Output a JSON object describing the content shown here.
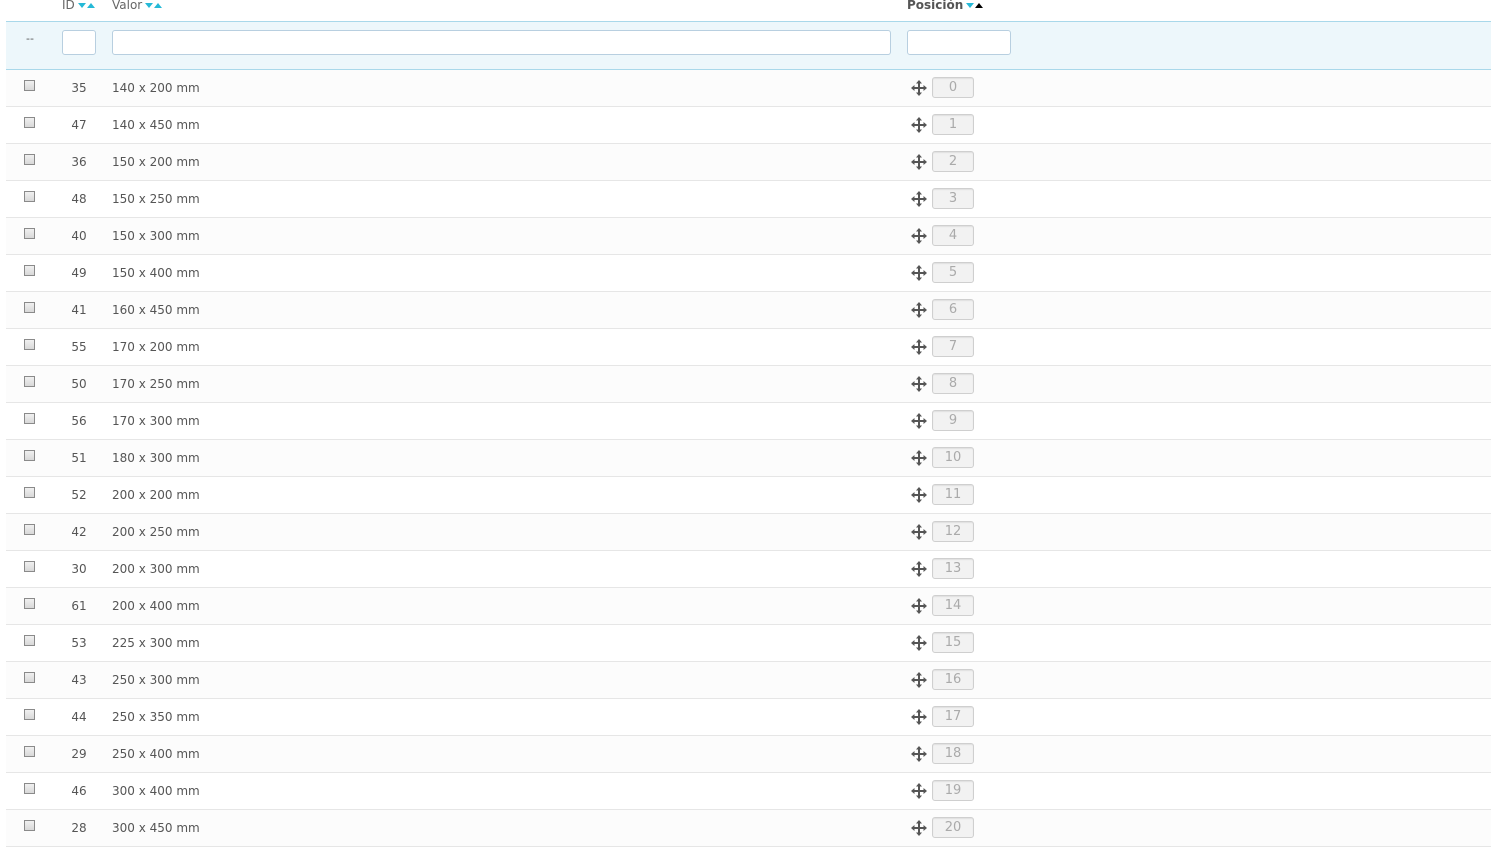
{
  "header": {
    "id_label": "ID",
    "value_label": "Valor",
    "position_label": "Posición",
    "filter_placeholder": "--"
  },
  "rows": [
    {
      "id": "35",
      "value": "140 x 200 mm",
      "position": "0"
    },
    {
      "id": "47",
      "value": "140 x 450 mm",
      "position": "1"
    },
    {
      "id": "36",
      "value": "150 x 200 mm",
      "position": "2"
    },
    {
      "id": "48",
      "value": "150 x 250 mm",
      "position": "3"
    },
    {
      "id": "40",
      "value": "150 x 300 mm",
      "position": "4"
    },
    {
      "id": "49",
      "value": "150 x 400 mm",
      "position": "5"
    },
    {
      "id": "41",
      "value": "160 x 450 mm",
      "position": "6"
    },
    {
      "id": "55",
      "value": "170 x 200 mm",
      "position": "7"
    },
    {
      "id": "50",
      "value": "170 x 250 mm",
      "position": "8"
    },
    {
      "id": "56",
      "value": "170 x 300 mm",
      "position": "9"
    },
    {
      "id": "51",
      "value": "180 x 300 mm",
      "position": "10"
    },
    {
      "id": "52",
      "value": "200 x 200 mm",
      "position": "11"
    },
    {
      "id": "42",
      "value": "200 x 250 mm",
      "position": "12"
    },
    {
      "id": "30",
      "value": "200 x 300 mm",
      "position": "13"
    },
    {
      "id": "61",
      "value": "200 x 400 mm",
      "position": "14"
    },
    {
      "id": "53",
      "value": "225 x 300 mm",
      "position": "15"
    },
    {
      "id": "43",
      "value": "250 x 300 mm",
      "position": "16"
    },
    {
      "id": "44",
      "value": "250 x 350 mm",
      "position": "17"
    },
    {
      "id": "29",
      "value": "250 x 400 mm",
      "position": "18"
    },
    {
      "id": "46",
      "value": "300 x 400 mm",
      "position": "19"
    },
    {
      "id": "28",
      "value": "300 x 450 mm",
      "position": "20"
    }
  ],
  "colors": {
    "accent": "#25b9d7",
    "filter_bg": "#edf7fb"
  },
  "icons": {
    "sort_desc": "sort-desc-icon",
    "sort_asc": "sort-asc-icon",
    "drag": "drag-move-icon"
  }
}
